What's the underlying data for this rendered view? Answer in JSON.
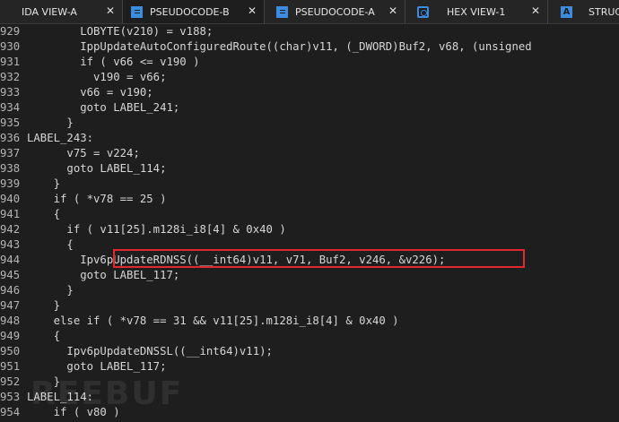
{
  "tabs": [
    {
      "label": "IDA VIEW-A",
      "icon": "none",
      "closable": true,
      "active": false
    },
    {
      "label": "PSEUDOCODE-B",
      "icon": "pseudocode-icon",
      "closable": true,
      "active": true
    },
    {
      "label": "PSEUDOCODE-A",
      "icon": "pseudocode-icon",
      "closable": true,
      "active": false
    },
    {
      "label": "HEX VIEW-1",
      "icon": "hex-view-icon",
      "closable": true,
      "active": false
    },
    {
      "label": "STRUC",
      "icon": "struct-icon",
      "closable": false,
      "active": false
    }
  ],
  "code_lines": [
    {
      "num": "929",
      "text": "        LOBYTE(v210) = v188;"
    },
    {
      "num": "930",
      "text": "        IppUpdateAutoConfiguredRoute((char)v11, (_DWORD)Buf2, v68, (unsigned"
    },
    {
      "num": "931",
      "text": "        if ( v66 <= v190 )"
    },
    {
      "num": "932",
      "text": "          v190 = v66;"
    },
    {
      "num": "933",
      "text": "        v66 = v190;"
    },
    {
      "num": "934",
      "text": "        goto LABEL_241;"
    },
    {
      "num": "935",
      "text": "      }"
    },
    {
      "num": "936",
      "text": "LABEL_243:"
    },
    {
      "num": "937",
      "text": "      v75 = v224;"
    },
    {
      "num": "938",
      "text": "      goto LABEL_114;"
    },
    {
      "num": "939",
      "text": "    }"
    },
    {
      "num": "940",
      "text": "    if ( *v78 == 25 )"
    },
    {
      "num": "941",
      "text": "    {"
    },
    {
      "num": "942",
      "text": "      if ( v11[25].m128i_i8[4] & 0x40 )"
    },
    {
      "num": "943",
      "text": "      {"
    },
    {
      "num": "944",
      "text": "        Ipv6pUpdateRDNSS((__int64)v11, v71, Buf2, v246, &v226);"
    },
    {
      "num": "945",
      "text": "        goto LABEL_117;"
    },
    {
      "num": "946",
      "text": "      }"
    },
    {
      "num": "947",
      "text": "    }"
    },
    {
      "num": "948",
      "text": "    else if ( *v78 == 31 && v11[25].m128i_i8[4] & 0x40 )"
    },
    {
      "num": "949",
      "text": "    {"
    },
    {
      "num": "950",
      "text": "      Ipv6pUpdateDNSSL((__int64)v11);"
    },
    {
      "num": "951",
      "text": "      goto LABEL_117;"
    },
    {
      "num": "952",
      "text": "    }"
    },
    {
      "num": "953",
      "text": "LABEL_114:"
    },
    {
      "num": "954",
      "text": "    if ( v80 )"
    }
  ],
  "highlighted_line": "944",
  "watermark": "REEBUF",
  "colors": {
    "highlight_border": "#e0282e",
    "accent_icon": "#3c8ce0",
    "background": "#1e1e1e"
  }
}
